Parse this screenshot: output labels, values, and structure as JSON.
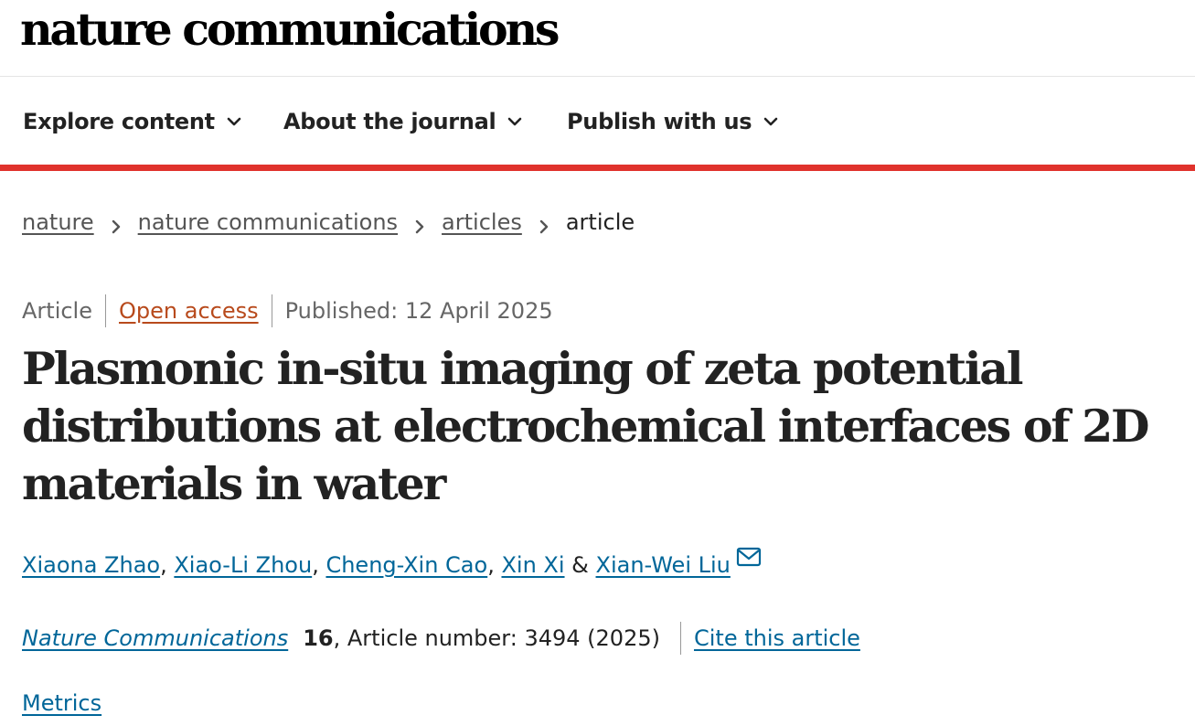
{
  "header": {
    "logo": "nature communications"
  },
  "nav": {
    "items": [
      {
        "label": "Explore content"
      },
      {
        "label": "About the journal"
      },
      {
        "label": "Publish with us"
      }
    ]
  },
  "colors": {
    "accent_bar": "#e0322c",
    "link": "#006699",
    "open_access": "#b84a1c"
  },
  "breadcrumb": {
    "items": [
      "nature",
      "nature communications",
      "articles"
    ],
    "current": "article"
  },
  "article": {
    "type": "Article",
    "access": "Open access",
    "published": "Published: 12 April 2025",
    "title": "Plasmonic in-situ imaging of zeta potential distributions at electrochemical interfaces of 2D materials in water",
    "authors": [
      "Xiaona Zhao",
      "Xiao-Li Zhou",
      "Cheng-Xin Cao",
      "Xin Xi",
      "Xian-Wei Liu"
    ],
    "author_separators": {
      "comma": ", ",
      "ampersand": " & "
    },
    "journal": "Nature Communications",
    "volume": "16",
    "article_number": ", Article number: 3494 (2025)",
    "cite_label": "Cite this article",
    "metrics_label": "Metrics"
  },
  "icons": {
    "nav_chevron": "chevron-down-icon",
    "breadcrumb_separator": "chevron-right-icon",
    "author_contact": "envelope-icon"
  }
}
